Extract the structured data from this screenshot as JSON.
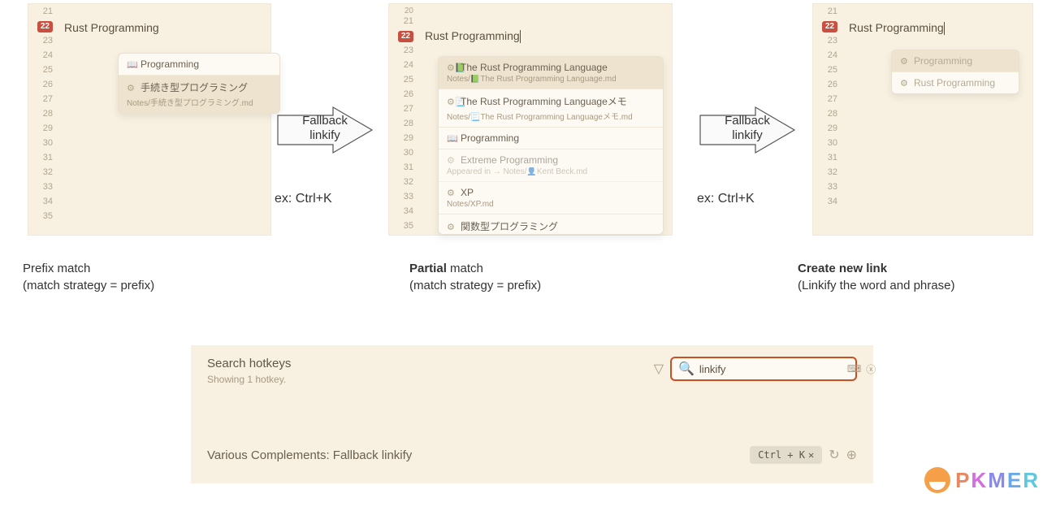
{
  "panel_common": {
    "line_text": "Rust Programming",
    "active_line": "22"
  },
  "panel1": {
    "popup": [
      {
        "icon": "📖",
        "title": "Programming",
        "sub": ""
      },
      {
        "icon": "⚙",
        "title": "手続き型プログラミング",
        "sub": "Notes/手続き型プログラミング.md",
        "selected": true
      }
    ]
  },
  "panel2": {
    "popup": [
      {
        "icon": "⚙📗",
        "title": "The Rust Programming Language",
        "sub": "Notes/📗The Rust Programming Language.md",
        "selected": true
      },
      {
        "icon": "⚙📃",
        "title": "The Rust Programming Languageメモ",
        "sub": "Notes/📃The Rust Programming Languageメモ.md"
      },
      {
        "icon": "📖",
        "title": "Programming",
        "sub": ""
      },
      {
        "icon": "⚙",
        "title": "Extreme Programming",
        "sub": "Appeared in → Notes/👤Kent Beck.md",
        "faded": true
      },
      {
        "icon": "⚙",
        "title": "XP",
        "sub": "Notes/XP.md"
      },
      {
        "icon": "⚙",
        "title": "関数型プログラミング",
        "sub": ""
      }
    ]
  },
  "panel3": {
    "popup": [
      {
        "icon": "⚙",
        "title": "Programming",
        "selected": true
      },
      {
        "icon": "⚙",
        "title": "Rust Programming"
      }
    ]
  },
  "arrow1": {
    "label_top": "Fallback",
    "label_bottom": "linkify",
    "ex": "ex: Ctrl+K"
  },
  "arrow2": {
    "label_top": "Fallback",
    "label_bottom": "linkify",
    "ex": "ex: Ctrl+K"
  },
  "caption1": {
    "line1": "Prefix match",
    "line2": "(match strategy = prefix)"
  },
  "caption2": {
    "bold": "Partial",
    "rest": " match",
    "line2": "(match strategy = prefix)"
  },
  "caption3": {
    "bold": "Create new link",
    "line2": "(Linkify the word and phrase)"
  },
  "settings": {
    "header": "Search hotkeys",
    "sub": "Showing 1 hotkey.",
    "search_value": "linkify",
    "row_name": "Various Complements: Fallback linkify",
    "kbd": "Ctrl + K",
    "kbd_x": "✕"
  },
  "watermark": {
    "p": "P",
    "k": "K",
    "m": "M",
    "e": "E",
    "r": "R"
  },
  "line_numbers": [
    21,
    22,
    23,
    24,
    25,
    26,
    27,
    28,
    29,
    30,
    31,
    32,
    33,
    34,
    35
  ]
}
